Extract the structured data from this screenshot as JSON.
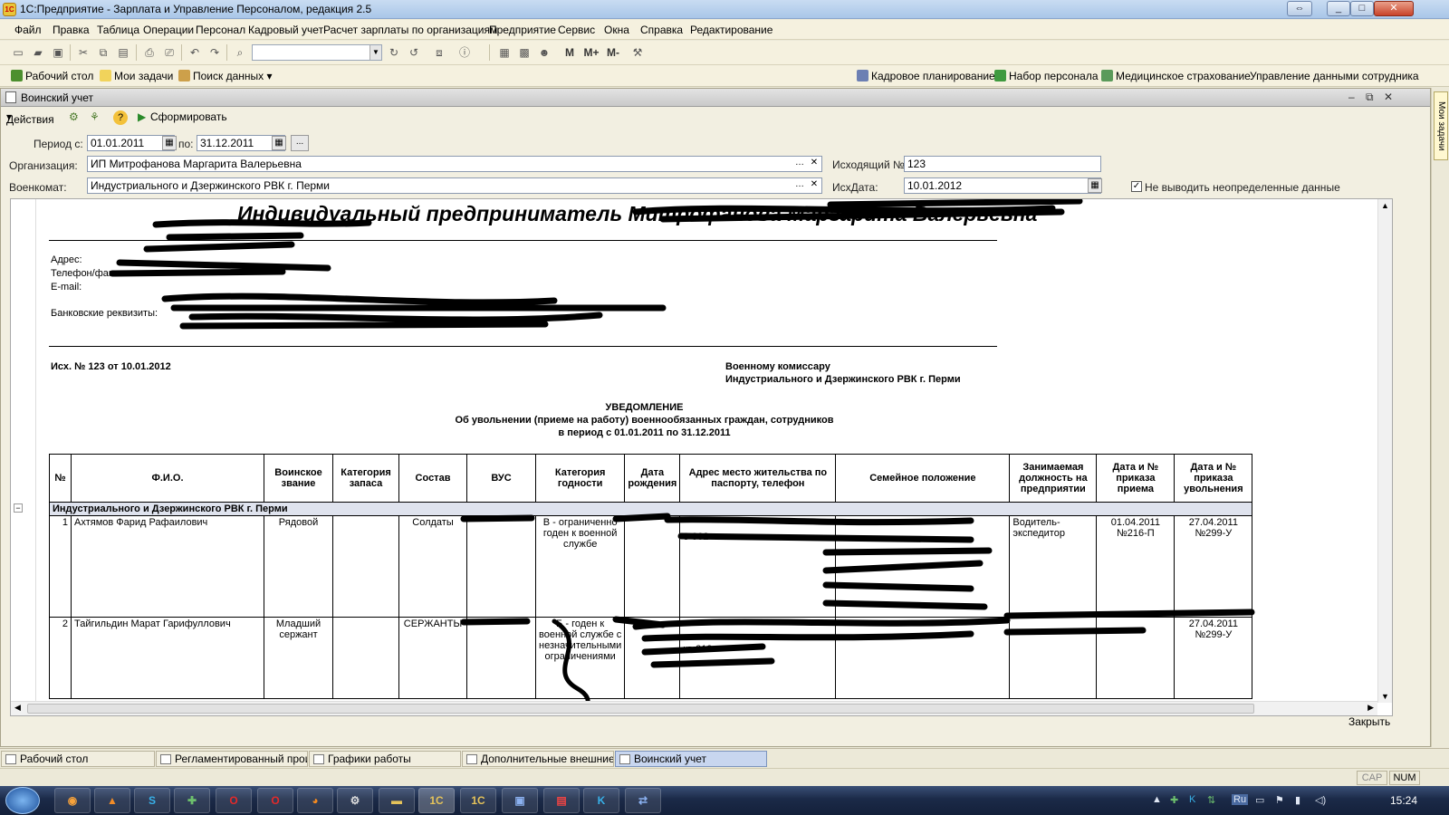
{
  "window": {
    "title": "1С:Предприятие - Зарплата и Управление Персоналом, редакция 2.5"
  },
  "menu": [
    "Файл",
    "Правка",
    "Таблица",
    "Операции",
    "Персонал",
    "Кадровый учет",
    "Расчет зарплаты по организациям",
    "Предприятие",
    "Сервис",
    "Окна",
    "Справка",
    "Редактирование"
  ],
  "toolbar": {
    "m1": "M",
    "m2": "M+",
    "m3": "M-"
  },
  "panel": {
    "left": [
      "Рабочий стол",
      "Мои задачи",
      "Поиск данных"
    ],
    "right": [
      "Кадровое планирование",
      "Набор персонала",
      "Медицинское страхование",
      "Управление данными сотрудника"
    ]
  },
  "form": {
    "title": "Воинский учет",
    "actions_label": "Действия",
    "generate_label": "Сформировать",
    "period_from_label": "Период с:",
    "period_from": "01.01.2011",
    "period_to_label": "по:",
    "period_to": "31.12.2011",
    "period_more": "...",
    "org_label": "Организация:",
    "org_value": "ИП Митрофанова Маргарита Валерьевна",
    "outgoing_no_label": "Исходящий №:",
    "outgoing_no": "123",
    "military_label": "Военкомат:",
    "military_value": "Индустриального и Дзержинского РВК г. Перми",
    "outgoing_date_label": "ИсхДата:",
    "outgoing_date": "10.01.2012",
    "checkbox_label": "Не выводить неопределенные данные",
    "close_label": "Закрыть"
  },
  "report": {
    "header": "Индивидуальный предприниматель Митрофанова Маргарита Валерьевна",
    "address_label": "Адрес:",
    "phone_label": "Телефон/факс:",
    "email_label": "E-mail:",
    "bank_label": "Банковские реквизиты:",
    "outgoing_ref": "Исх. № 123 от 10.01.2012",
    "to_line1": "Военному комиссару",
    "to_line2": "Индустриального и Дзержинского РВК г. Перми",
    "notice_title": "УВЕДОМЛЕНИЕ",
    "notice_sub1": "Об увольнении (приеме на работу) военнообязанных граждан, сотрудников",
    "notice_sub2": "в период с 01.01.2011 по 31.12.2011",
    "columns": [
      "№",
      "Ф.И.О.",
      "Воинское звание",
      "Категория запаса",
      "Состав",
      "ВУС",
      "Категория годности",
      "Дата рождения",
      "Адрес место жительства по паспорту, телефон",
      "Семейное положение",
      "Занимаемая должность на предприятии",
      "Дата и № приказа приема",
      "Дата и № приказа увольнения"
    ],
    "group": "Индустриального и Дзержинского РВК г. Перми",
    "rows": [
      {
        "n": "1",
        "fio": "Ахтямов Фарид Рафаилович",
        "rank": "Рядовой",
        "reserve": "",
        "composition": "Солдаты",
        "vus": "",
        "fitness": "В - ограниченно годен к военной службе",
        "birth": "",
        "address": "8-902",
        "family": "",
        "position": "Водитель-экспедитор",
        "hire": "01.04.2011 №216-П",
        "fire": "27.04.2011 №299-У"
      },
      {
        "n": "2",
        "fio": "Тайгильдин Марат Гарифуллович",
        "rank": "Младший сержант",
        "reserve": "",
        "composition": "СЕРЖАНТЫ",
        "vus": "",
        "fitness": "Б - годен к военной службе с незначительными ограничениями",
        "birth": "",
        "address": "кв.212",
        "family": "",
        "position": "",
        "hire": "",
        "fire": "27.04.2011 №299-У"
      }
    ]
  },
  "window_tabs": [
    "Рабочий стол",
    "Регламентированный прои...",
    "Графики работы",
    "Дополнительные внешние ...",
    "Воинский учет"
  ],
  "right_strip": "Мои задачи",
  "status": {
    "cap": "CAP",
    "num": "NUM"
  },
  "taskbar": {
    "clock": "15:24",
    "lang": "Ru"
  }
}
